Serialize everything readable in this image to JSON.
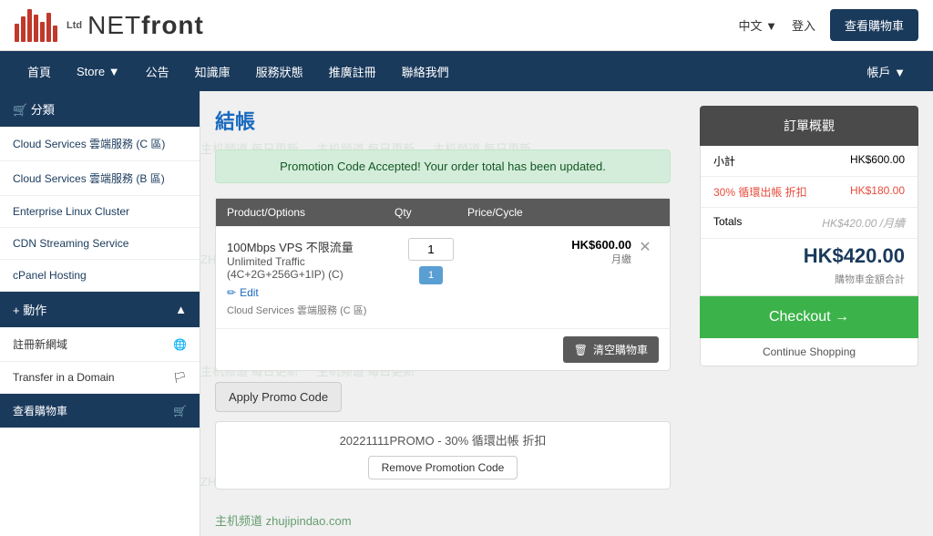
{
  "header": {
    "logo_ltd": "Ltd",
    "logo_name": "NETfront",
    "lang_label": "中文 ▼",
    "login_label": "登入",
    "cart_button": "查看購物車"
  },
  "navbar": {
    "items": [
      {
        "label": "首頁"
      },
      {
        "label": "Store ▼"
      },
      {
        "label": "公告"
      },
      {
        "label": "知識庫"
      },
      {
        "label": "服務狀態"
      },
      {
        "label": "推廣註冊"
      },
      {
        "label": "聯絡我們"
      }
    ],
    "account": "帳戶 ▼"
  },
  "sidebar": {
    "category_label": "🛒 分類",
    "items": [
      {
        "label": "Cloud Services 雲端服務 (C 區)"
      },
      {
        "label": "Cloud Services 雲端服務 (B 區)"
      },
      {
        "label": "Enterprise Linux Cluster"
      },
      {
        "label": "CDN Streaming Service"
      },
      {
        "label": "cPanel Hosting"
      }
    ],
    "actions_label": "+ 動作",
    "action_items": [
      {
        "label": "註冊新網域",
        "icon": "🌐"
      },
      {
        "label": "Transfer in a Domain",
        "icon": "🏳"
      },
      {
        "label": "查看購物車",
        "icon": "🛒",
        "active": true
      }
    ]
  },
  "page": {
    "title": "結帳",
    "promo_banner": "Promotion Code Accepted! Your order total has been updated.",
    "table": {
      "headers": [
        "Product/Options",
        "Qty",
        "Price/Cycle",
        ""
      ],
      "rows": [
        {
          "product": "100Mbps VPS 不限流量",
          "sub1": "Unlimited Traffic",
          "sub2": "(4C+2G+256G+1IP) (C)",
          "edit": "Edit",
          "cloud_service": "Cloud Services 雲端服務 (C 區)",
          "qty": "1",
          "price": "HK$600.00",
          "cycle": "月繳"
        }
      ]
    },
    "clear_cart": "清空購物車",
    "apply_promo": "Apply Promo Code",
    "promo_code_applied": "20221111PROMO - 30% 循環出帳 折扣",
    "remove_promo": "Remove Promotion Code"
  },
  "order_summary": {
    "title": "訂單概觀",
    "subtotal_label": "小計",
    "subtotal_value": "HK$600.00",
    "discount_label": "30% 循環出帳 折扣",
    "discount_value": "HK$180.00",
    "totals_label": "Totals",
    "totals_value": "HK$420.00 /月續",
    "total_price": "HK$420.00",
    "cart_total_label": "購物車金額合計",
    "checkout_btn": "Checkout →",
    "continue_shopping": "Continue Shopping"
  },
  "watermark": {
    "text1": "主机频道 每日更新",
    "text2": "ZHUJIPINDAO.COM"
  },
  "footer": {
    "text": "主机频道  zhujipindao.com"
  }
}
